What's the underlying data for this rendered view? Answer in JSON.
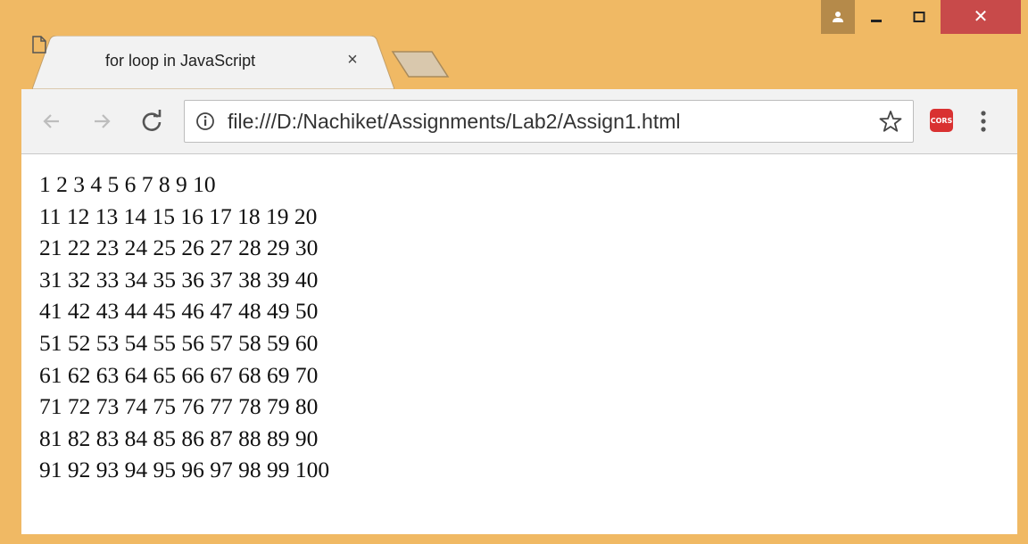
{
  "tab": {
    "title": "for loop in JavaScript",
    "close_label": "×"
  },
  "window": {
    "close_label": "✕"
  },
  "toolbar": {
    "url": "file:///D:/Nachiket/Assignments/Lab2/Assign1.html",
    "extension_label": "CORS"
  },
  "icons": {
    "profile": "person-icon",
    "minimize": "minimize-icon",
    "maximize": "maximize-icon",
    "close": "close-icon",
    "tab_favicon": "document-icon",
    "back": "arrow-left-icon",
    "forward": "arrow-right-icon",
    "reload": "reload-icon",
    "info": "info-icon",
    "bookmark": "star-icon",
    "menu": "kebab-menu-icon"
  },
  "colors": {
    "frame": "#f0b964",
    "close_button": "#c84a4a",
    "profile_button": "#b58a4a",
    "extension": "#d93131"
  },
  "page": {
    "lines": [
      "1 2 3 4 5 6 7 8 9 10",
      "11 12 13 14 15 16 17 18 19 20",
      "21 22 23 24 25 26 27 28 29 30",
      "31 32 33 34 35 36 37 38 39 40",
      "41 42 43 44 45 46 47 48 49 50",
      "51 52 53 54 55 56 57 58 59 60",
      "61 62 63 64 65 66 67 68 69 70",
      "71 72 73 74 75 76 77 78 79 80",
      "81 82 83 84 85 86 87 88 89 90",
      "91 92 93 94 95 96 97 98 99 100"
    ]
  }
}
